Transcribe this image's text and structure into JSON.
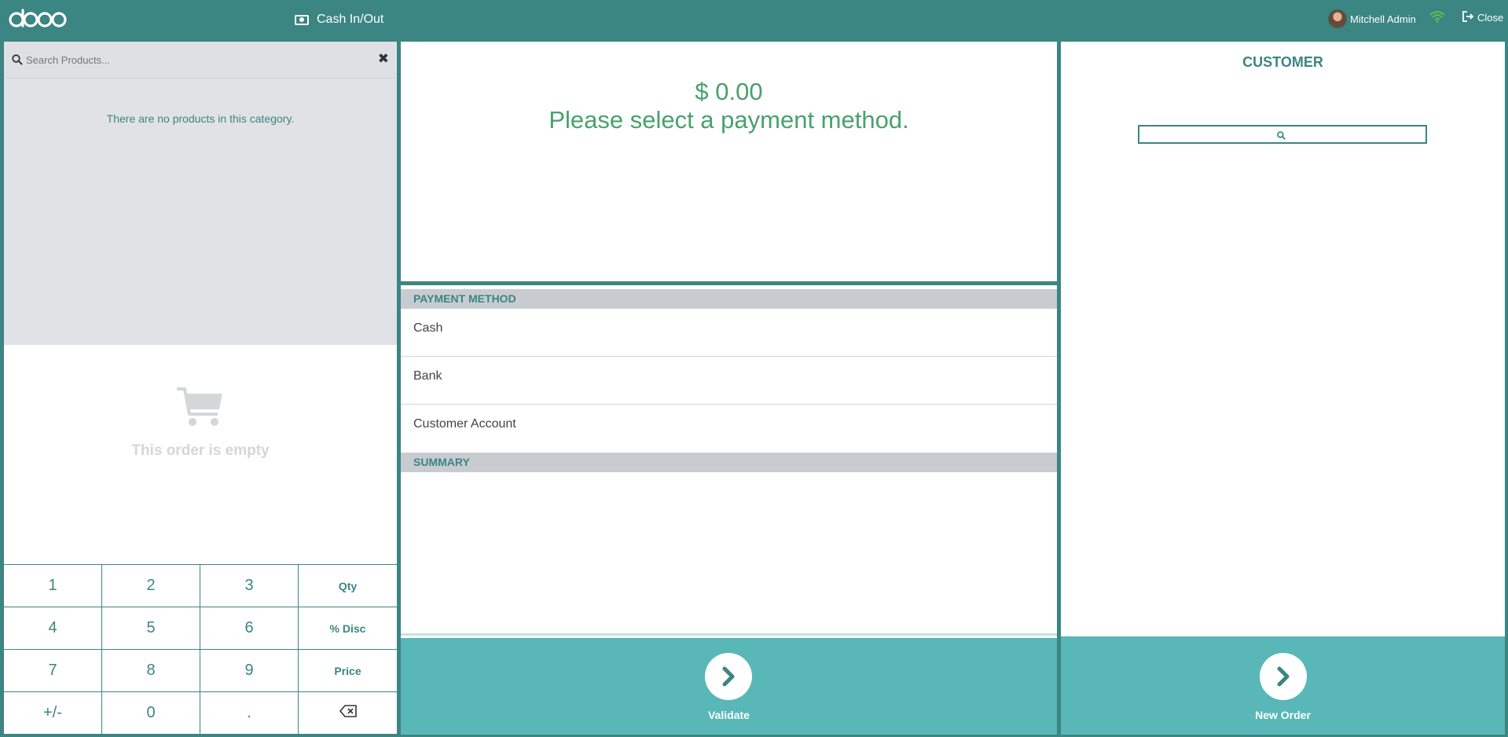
{
  "header": {
    "logo_text": "odoo",
    "cash_inout_label": "Cash In/Out",
    "user_name": "Mitchell Admin",
    "close_label": "Close"
  },
  "products": {
    "search_placeholder": "Search Products...",
    "empty_category_text": "There are no products in this category."
  },
  "order": {
    "empty_text": "This order is empty"
  },
  "numpad": {
    "keys": [
      "1",
      "2",
      "3",
      "Qty",
      "4",
      "5",
      "6",
      "% Disc",
      "7",
      "8",
      "9",
      "Price",
      "+/-",
      "0",
      ".",
      "backspace"
    ]
  },
  "payment": {
    "total_amount": "$ 0.00",
    "message": "Please select a payment method.",
    "method_header": "PAYMENT METHOD",
    "methods": [
      "Cash",
      "Bank",
      "Customer Account"
    ],
    "summary_header": "SUMMARY",
    "validate_label": "Validate"
  },
  "customer": {
    "title": "CUSTOMER",
    "new_order_label": "New Order"
  },
  "colors": {
    "primary": "#3b8582",
    "accent_bar": "#59b7b7",
    "amount_green": "#48a16c",
    "wifi_green": "#5ec24c"
  }
}
